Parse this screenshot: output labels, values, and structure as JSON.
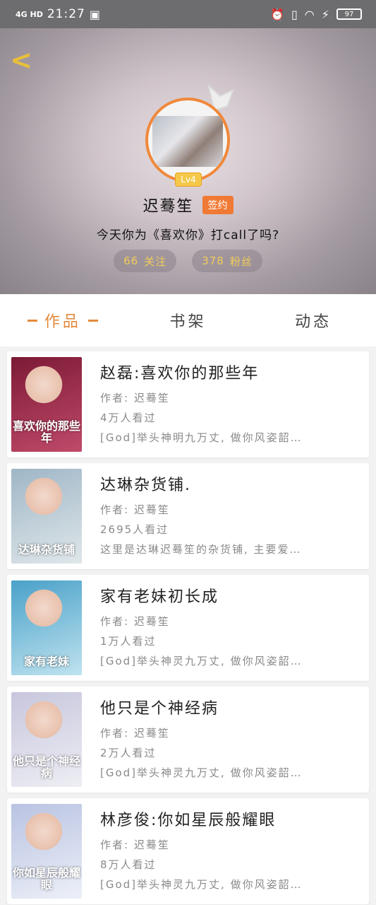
{
  "status_bar": {
    "network": "4G HD",
    "time": "21:27",
    "battery": "97"
  },
  "profile": {
    "level": "Lv4",
    "name": "迟蓦笙",
    "signed_label": "签约",
    "bio": "今天你为《喜欢你》打call了吗?",
    "following_count": "66",
    "following_label": "关注",
    "followers_count": "378",
    "followers_label": "粉丝"
  },
  "tabs": [
    {
      "label": "作品",
      "active": true
    },
    {
      "label": "书架",
      "active": false
    },
    {
      "label": "动态",
      "active": false
    }
  ],
  "books": [
    {
      "title": "赵磊:喜欢你的那些年",
      "author": "作者: 迟蓦笙",
      "views": "4万人看过",
      "desc": "[God]举头神明九万丈, 做你风姿韶…",
      "cover_text": "喜欢你的那些年",
      "cover_colors": [
        "#7c1a35",
        "#c04a6a"
      ]
    },
    {
      "title": "达琳杂货铺.",
      "author": "作者: 迟蓦笙",
      "views": "2695人看过",
      "desc": "这里是达琳迟蓦笙的杂货铺, 主要爱…",
      "cover_text": "达琳杂货铺",
      "cover_colors": [
        "#9fb6c6",
        "#dfe7ea"
      ]
    },
    {
      "title": "家有老妹初长成",
      "author": "作者: 迟蓦笙",
      "views": "1万人看过",
      "desc": "[God]举头神灵九万丈, 做你风姿韶…",
      "cover_text": "家有老妹",
      "cover_colors": [
        "#4aa1c9",
        "#bfe3ef"
      ]
    },
    {
      "title": "他只是个神经病",
      "author": "作者: 迟蓦笙",
      "views": "2万人看过",
      "desc": "[God]举头神灵九万丈, 做你风姿韶…",
      "cover_text": "他只是个神经病",
      "cover_colors": [
        "#c7c6dd",
        "#eeeef4"
      ]
    },
    {
      "title": "林彦俊:你如星辰般耀眼",
      "author": "作者: 迟蓦笙",
      "views": "8万人看过",
      "desc": "[God]举头神灵九万丈, 做你风姿韶…",
      "cover_text": "你如星辰般耀眼",
      "cover_colors": [
        "#b9c3e2",
        "#edf0f8"
      ]
    }
  ]
}
